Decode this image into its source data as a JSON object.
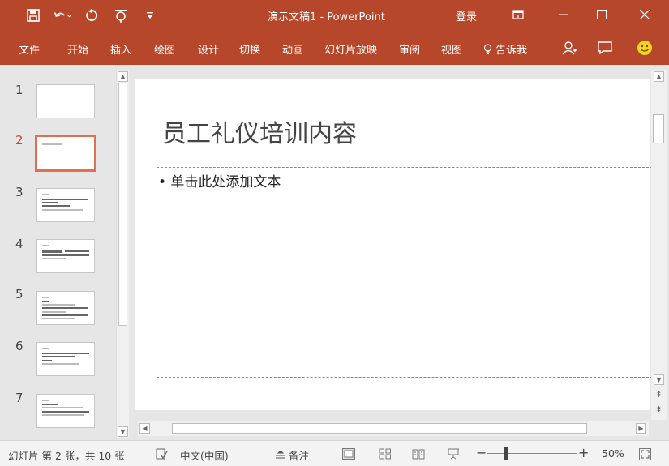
{
  "titlebar": {
    "title": "演示文稿1  -  PowerPoint",
    "signin": "登录"
  },
  "ribbon": {
    "tabs": [
      "文件",
      "开始",
      "插入",
      "绘图",
      "设计",
      "切换",
      "动画",
      "幻灯片放映",
      "审阅",
      "视图"
    ],
    "tell_me": "告诉我"
  },
  "thumbnails": {
    "numbers": [
      "1",
      "2",
      "3",
      "4",
      "5",
      "6",
      "7"
    ],
    "active": 2
  },
  "slide": {
    "title": "员工礼仪培训内容",
    "body": "• 单击此处添加文本"
  },
  "status": {
    "slide_info": "幻灯片 第 2 张，共 10 张",
    "language": "中文(中国)",
    "notes": "备注",
    "zoom": "50%"
  },
  "colors": {
    "accent": "#b7472a",
    "active_thumb_border": "#e07050"
  }
}
